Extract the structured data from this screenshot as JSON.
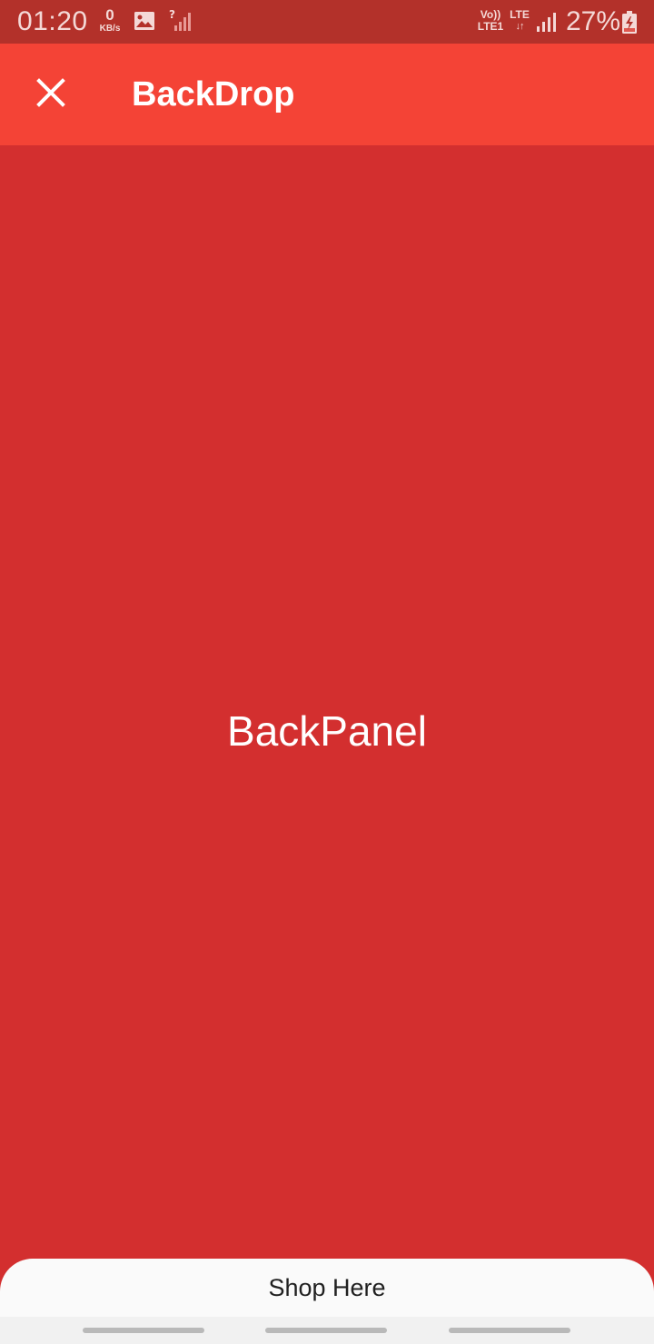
{
  "status_bar": {
    "time": "01:20",
    "speed_value": "0",
    "speed_unit": "KB/s",
    "volte_top": "Vo))",
    "volte_bottom": "LTE1",
    "network_type": "LTE",
    "network_arrows": "↓↑",
    "battery_percent": "27%",
    "icons": [
      "image-icon",
      "no-signal-icon",
      "signal-icon",
      "battery-charging-icon"
    ]
  },
  "app_bar": {
    "title": "BackDrop",
    "leading_icon": "close-icon",
    "background_color": "#f44336"
  },
  "back_panel": {
    "label": "BackPanel",
    "background_color": "#d32f2f"
  },
  "front_sheet": {
    "title": "Shop Here"
  }
}
